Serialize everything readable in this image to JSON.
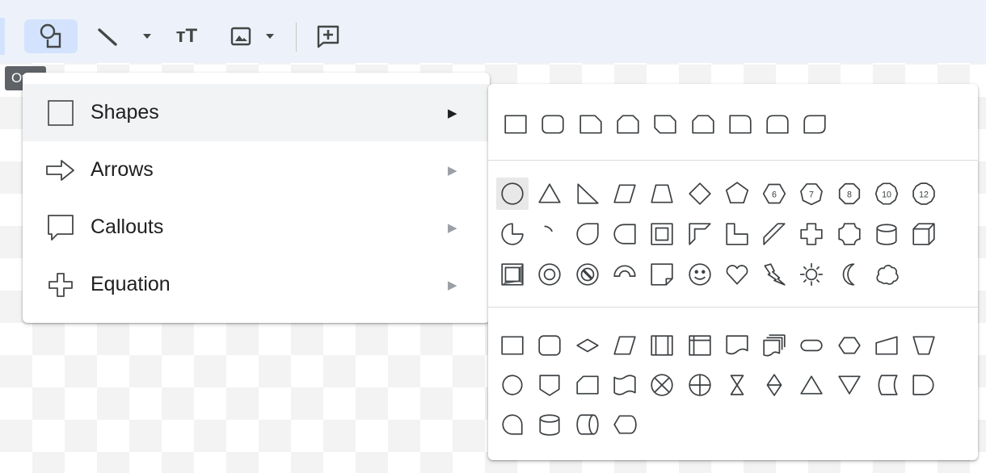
{
  "toolbar": {
    "buttons": [
      {
        "name": "shape-button",
        "icon": "shape-icon"
      },
      {
        "name": "line-button",
        "icon": "line-icon"
      },
      {
        "name": "line-dropdown",
        "icon": "chevron-down-icon"
      },
      {
        "name": "text-box-button",
        "icon": "text-box-icon"
      },
      {
        "name": "image-button",
        "icon": "image-icon"
      },
      {
        "name": "image-dropdown",
        "icon": "chevron-down-icon"
      },
      {
        "name": "add-comment-button",
        "icon": "add-comment-icon"
      }
    ],
    "text_box_glyph": "тT",
    "tooltip": "Oval"
  },
  "menu": {
    "items": [
      {
        "label": "Shapes",
        "icon": "square-icon",
        "arrow": "▶",
        "highlighted": true
      },
      {
        "label": "Arrows",
        "icon": "arrow-right-icon",
        "arrow": "▶"
      },
      {
        "label": "Callouts",
        "icon": "callout-icon",
        "arrow": "▶"
      },
      {
        "label": "Equation",
        "icon": "plus-outline-icon",
        "arrow": "▶"
      }
    ]
  },
  "submenu": {
    "selected_shape": "Oval",
    "sections": [
      {
        "name": "rectangles",
        "count": 9
      },
      {
        "name": "basic-shapes",
        "count": 36
      },
      {
        "name": "flowchart",
        "count": 28
      }
    ],
    "octagon_numbers": [
      "6",
      "7",
      "8",
      "10",
      "12"
    ]
  },
  "colors": {
    "toolbar_bg": "#edf2fa",
    "highlight": "#f1f3f4",
    "stroke": "#3c4043",
    "tooltip_bg": "#5f6368"
  }
}
